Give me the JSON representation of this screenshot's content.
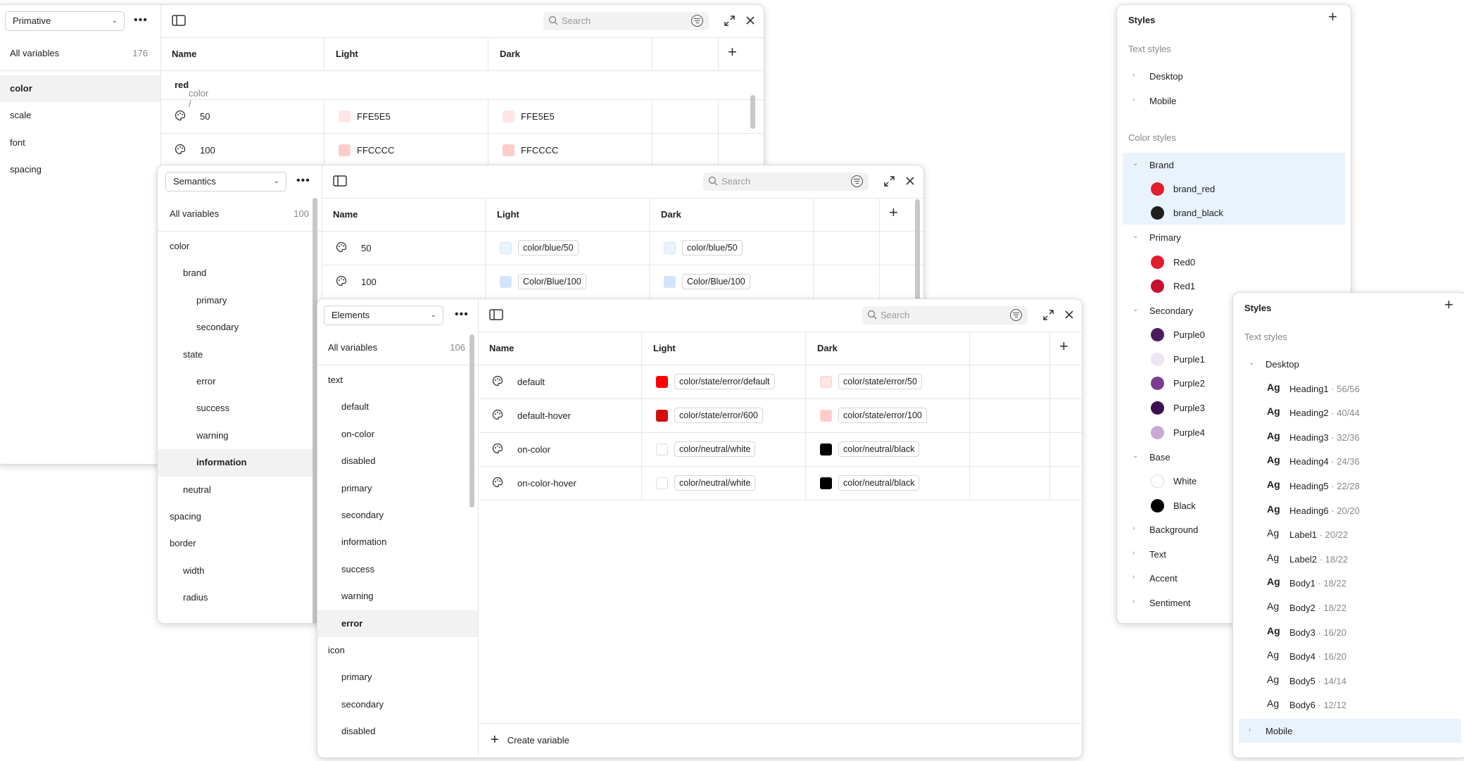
{
  "primitive": {
    "collection": "Primative",
    "all_label": "All variables",
    "all_count": "176",
    "groups": [
      "color",
      "scale",
      "font",
      "spacing"
    ],
    "search_placeholder": "Search",
    "columns": [
      "Name",
      "Light",
      "Dark"
    ],
    "breadcrumb_parent": "color /",
    "breadcrumb_current": "red",
    "rows": [
      {
        "name": "50",
        "light": "FFE5E5",
        "dark": "FFE5E5",
        "light_color": "#ffe5e5",
        "dark_color": "#ffe5e5"
      },
      {
        "name": "100",
        "light": "FFCCCC",
        "dark": "FFCCCC",
        "light_color": "#ffcccc",
        "dark_color": "#ffcccc"
      }
    ]
  },
  "semantics": {
    "collection": "Semantics",
    "all_label": "All variables",
    "all_count": "100",
    "tree": [
      "color",
      "brand",
      "primary",
      "secondary",
      "state",
      "error",
      "success",
      "warning",
      "information",
      "neutral",
      "spacing",
      "border",
      "width",
      "radius"
    ],
    "search_placeholder": "Search",
    "columns": [
      "Name",
      "Light",
      "Dark"
    ],
    "rows": [
      {
        "name": "50",
        "light": "color/blue/50",
        "dark": "color/blue/50",
        "light_color": "#eaf2fd",
        "dark_color": "#eaf2fd"
      },
      {
        "name": "100",
        "light": "Color/Blue/100",
        "dark": "Color/Blue/100",
        "light_color": "#d2e4fc",
        "dark_color": "#d2e4fc"
      }
    ]
  },
  "elements": {
    "collection": "Elements",
    "all_label": "All variables",
    "all_count": "106",
    "tree": [
      "text",
      "default",
      "on-color",
      "disabled",
      "primary",
      "secondary",
      "information",
      "success",
      "warning",
      "error",
      "icon",
      "primary",
      "secondary",
      "disabled"
    ],
    "search_placeholder": "Search",
    "columns": [
      "Name",
      "Light",
      "Dark"
    ],
    "rows": [
      {
        "name": "default",
        "light": "color/state/error/default",
        "dark": "color/state/error/50",
        "light_color": "#ff0000",
        "dark_color": "#ffe5e5"
      },
      {
        "name": "default-hover",
        "light": "color/state/error/600",
        "dark": "color/state/error/100",
        "light_color": "#d40d0d",
        "dark_color": "#ffcccc"
      },
      {
        "name": "on-color",
        "light": "color/neutral/white",
        "dark": "color/neutral/black",
        "light_color": "#ffffff",
        "dark_color": "#000000"
      },
      {
        "name": "on-color-hover",
        "light": "color/neutral/white",
        "dark": "color/neutral/black",
        "light_color": "#ffffff",
        "dark_color": "#000000"
      }
    ],
    "create_label": "Create variable"
  },
  "styles_color": {
    "title": "Styles",
    "text_styles_label": "Text styles",
    "text_groups": [
      "Desktop",
      "Mobile"
    ],
    "color_styles_label": "Color styles",
    "brand_group": "Brand",
    "brand_items": [
      {
        "name": "brand_red",
        "color": "#e11d2e"
      },
      {
        "name": "brand_black",
        "color": "#1e1e1e"
      }
    ],
    "primary_group": "Primary",
    "primary_items": [
      {
        "name": "Red0",
        "color": "#e11d2e"
      },
      {
        "name": "Red1",
        "color": "#c8102e"
      }
    ],
    "secondary_group": "Secondary",
    "secondary_items": [
      {
        "name": "Purple0",
        "color": "#4b1d5e"
      },
      {
        "name": "Purple1",
        "color": "#ece4f0"
      },
      {
        "name": "Purple2",
        "color": "#7a3d8f"
      },
      {
        "name": "Purple3",
        "color": "#3d0f52"
      },
      {
        "name": "Purple4",
        "color": "#c9a8d6"
      }
    ],
    "base_group": "Base",
    "base_items": [
      {
        "name": "White",
        "color": "#ffffff"
      },
      {
        "name": "Black",
        "color": "#000000"
      }
    ],
    "other_groups": [
      "Background",
      "Text",
      "Accent",
      "Sentiment"
    ]
  },
  "styles_text": {
    "title": "Styles",
    "text_styles_label": "Text styles",
    "desktop_group": "Desktop",
    "glyph": "Ag",
    "items": [
      {
        "name": "Heading1",
        "size": "· 56/56",
        "bold": true
      },
      {
        "name": "Heading2",
        "size": "· 40/44",
        "bold": true
      },
      {
        "name": "Heading3",
        "size": "· 32/36",
        "bold": true
      },
      {
        "name": "Heading4",
        "size": "· 24/36",
        "bold": true
      },
      {
        "name": "Heading5",
        "size": "· 22/28",
        "bold": true
      },
      {
        "name": "Heading6",
        "size": "· 20/20",
        "bold": true
      },
      {
        "name": "Label1",
        "size": "· 20/22",
        "bold": false
      },
      {
        "name": "Label2",
        "size": "· 18/22",
        "bold": false
      },
      {
        "name": "Body1",
        "size": "· 18/22",
        "bold": false
      },
      {
        "name": "Body2",
        "size": "· 18/22",
        "bold": false
      },
      {
        "name": "Body3",
        "size": "· 16/20",
        "bold": false
      },
      {
        "name": "Body4",
        "size": "· 16/20",
        "bold": false
      },
      {
        "name": "Body5",
        "size": "· 14/14",
        "bold": false
      },
      {
        "name": "Body6",
        "size": "· 12/12",
        "bold": false
      }
    ],
    "mobile_group": "Mobile"
  }
}
